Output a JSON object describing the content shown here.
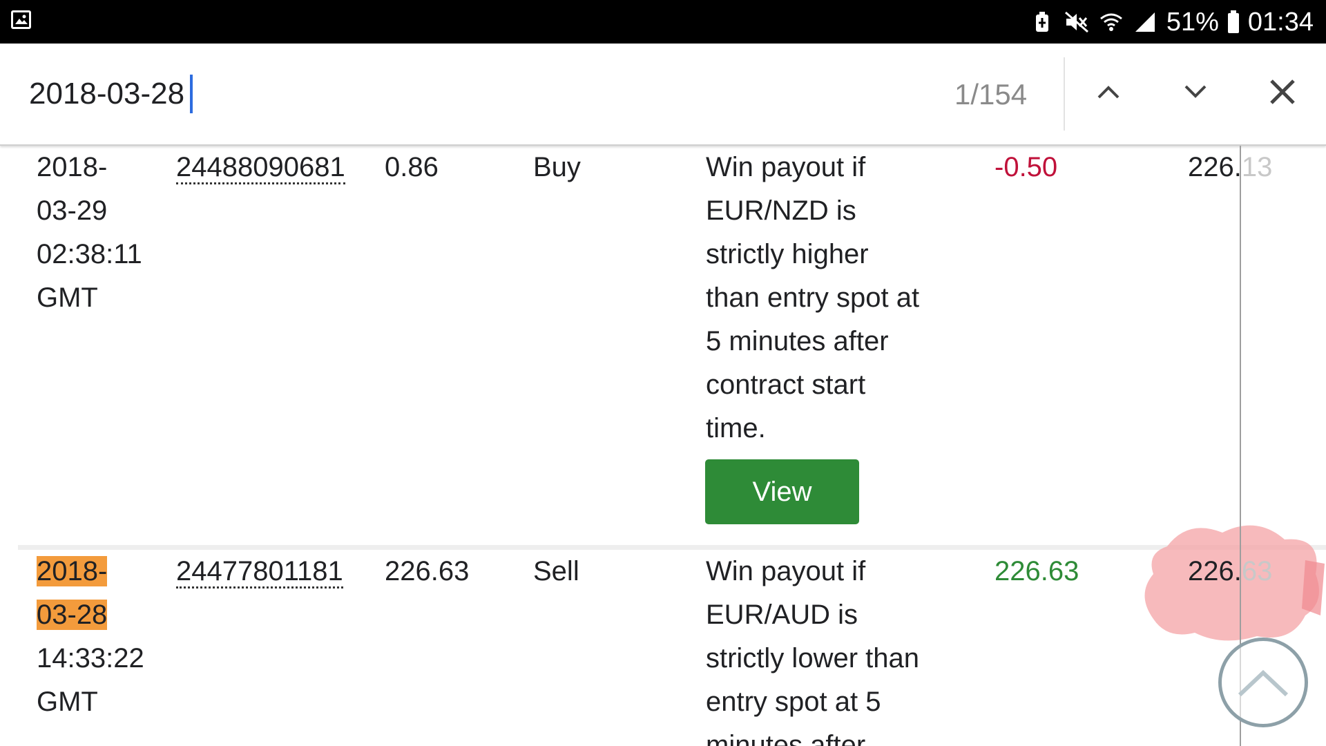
{
  "status_bar": {
    "battery": "51%",
    "time": "01:34",
    "icons": [
      "gallery-icon",
      "battery-saver-icon",
      "mute-icon",
      "wifi-icon",
      "signal-icon",
      "battery-icon"
    ]
  },
  "find_bar": {
    "query": "2018-03-28",
    "match_count": "1/154",
    "icons": [
      "chevron-up-icon",
      "chevron-down-icon",
      "close-icon"
    ]
  },
  "transactions": [
    {
      "date_lines": [
        "2018-",
        "03-29",
        "02:38:11",
        "GMT"
      ],
      "ref_id": "24488090681",
      "amount": "0.86",
      "action": "Buy",
      "description_lines": [
        "Win payout if",
        "EUR/NZD is",
        "strictly higher",
        "than entry spot at",
        "5 minutes after",
        "contract start",
        "time."
      ],
      "button": "View",
      "credit": "-0.50",
      "balance_visible": "226.",
      "balance_faded": "13"
    },
    {
      "date_lines": [
        "2018-",
        "03-28",
        "14:33:22",
        "GMT"
      ],
      "ref_id": "24477801181",
      "amount": "226.63",
      "action": "Sell",
      "description_lines": [
        "Win payout if",
        "EUR/AUD is",
        "strictly lower than",
        "entry spot at 5",
        "minutes after"
      ],
      "credit": "226.63",
      "balance_visible": "226.",
      "balance_faded": "63"
    }
  ],
  "colors": {
    "highlight": "#f39b3c",
    "negative": "#c0113a",
    "positive": "#2e8b37",
    "button_bg": "#2e8b37"
  }
}
